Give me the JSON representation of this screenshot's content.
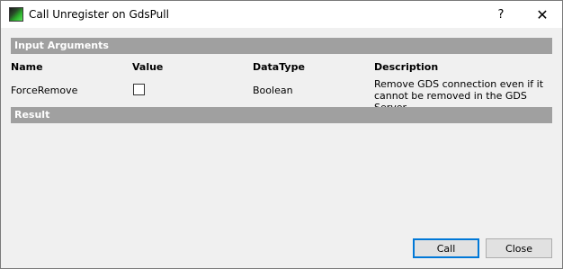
{
  "window": {
    "title": "Call Unregister on GdsPull",
    "help_label": "?",
    "close_label": "✕"
  },
  "input_arguments": {
    "header": "Input Arguments",
    "columns": [
      "Name",
      "Value",
      "DataType",
      "Description"
    ],
    "rows": [
      {
        "name": "ForceRemove",
        "value_checked": false,
        "datatype": "Boolean",
        "description": "Remove GDS connection even if it cannot be removed in the GDS Server"
      }
    ]
  },
  "result": {
    "header": "Result"
  },
  "buttons": {
    "call": "Call",
    "close": "Close"
  },
  "colors": {
    "section_header": "#a0a0a0",
    "default_button_border": "#0078d7",
    "window_background": "#f0f0f0"
  }
}
